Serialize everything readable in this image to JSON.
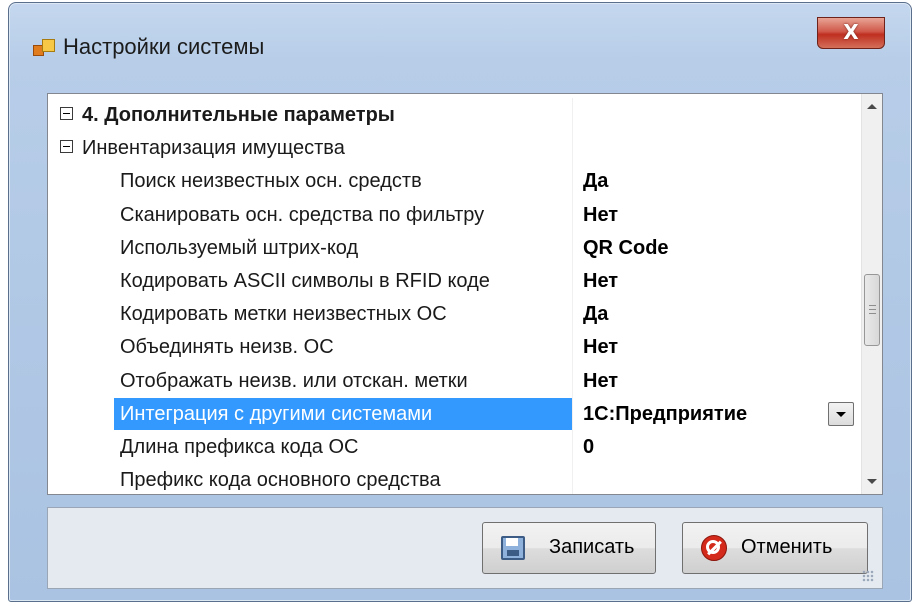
{
  "window": {
    "title": "Настройки системы",
    "close_glyph": "X"
  },
  "property_grid": {
    "rows": [
      {
        "kind": "category",
        "bold": true,
        "name": "4. Дополнительные параметры",
        "value": ""
      },
      {
        "kind": "category",
        "bold": false,
        "name": "Инвентаризация имущества",
        "value": ""
      },
      {
        "kind": "property",
        "name": "Поиск неизвестных осн. средств",
        "value": "Да"
      },
      {
        "kind": "property",
        "name": "Сканировать осн. средства по фильтру",
        "value": "Нет"
      },
      {
        "kind": "property",
        "name": "Используемый штрих-код",
        "value": "QR Code"
      },
      {
        "kind": "property",
        "name": "Кодировать ASCII символы в RFID коде",
        "value": "Нет"
      },
      {
        "kind": "property",
        "name": "Кодировать метки неизвестных ОС",
        "value": "Да"
      },
      {
        "kind": "property",
        "name": "Объединять неизв. ОС",
        "value": "Нет"
      },
      {
        "kind": "property",
        "name": "Отображать неизв. или отскан. метки",
        "value": "Нет"
      },
      {
        "kind": "property",
        "name": "Интеграция с другими системами",
        "value": "1С:Предприятие",
        "selected": true
      },
      {
        "kind": "property",
        "name": "Длина префикса кода ОС",
        "value": "0"
      },
      {
        "kind": "property",
        "name": "Префикс кода основного средства",
        "value": ""
      }
    ]
  },
  "footer": {
    "save_label": "Записать",
    "cancel_label": "Отменить"
  },
  "colors": {
    "selection": "#3399ff",
    "frame": "#b7cde8",
    "close_button": "#c43a2b"
  },
  "icons": [
    "app-icon",
    "close-icon",
    "collapse-icon",
    "dropdown-arrow-icon",
    "scroll-up-icon",
    "scroll-down-icon",
    "floppy-disk-icon",
    "stop-icon"
  ]
}
